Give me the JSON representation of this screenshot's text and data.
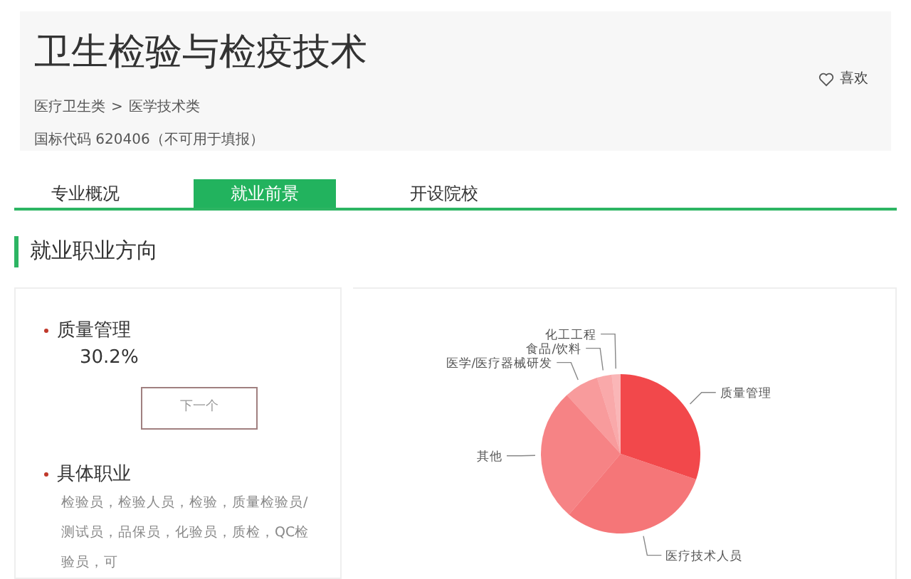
{
  "header": {
    "title": "卫生检验与检疫技术",
    "favorite": "喜欢",
    "breadcrumb": [
      "医疗卫生类",
      "医学技术类"
    ],
    "breadcrumb_separator": ">",
    "code": "国标代码 620406（不可用于填报）"
  },
  "tabs": [
    {
      "label": "专业概况",
      "selected": false
    },
    {
      "label": "就业前景",
      "selected": true
    },
    {
      "label": "开设院校",
      "selected": false
    }
  ],
  "section_title": "就业职业方向",
  "detail": {
    "name": "质量管理",
    "share": "30.2%",
    "next_button": "下一个",
    "jobs_title": "具体职业",
    "jobs_text": "检验员，检验人员，检验，质量检验员/测试员，品保员，化验员，质检，QC检验员，可"
  },
  "chart": {
    "chart_data": {
      "type": "pie",
      "categories": [
        "质量管理",
        "医疗技术人员",
        "其他",
        "医学/医疗器械研发",
        "食品/饮料",
        "化工工程"
      ],
      "series": [
        {
          "color": "#f2484b",
          "values": [
            30.2,
            31,
            27,
            7,
            3,
            1.8
          ]
        }
      ]
    }
  }
}
